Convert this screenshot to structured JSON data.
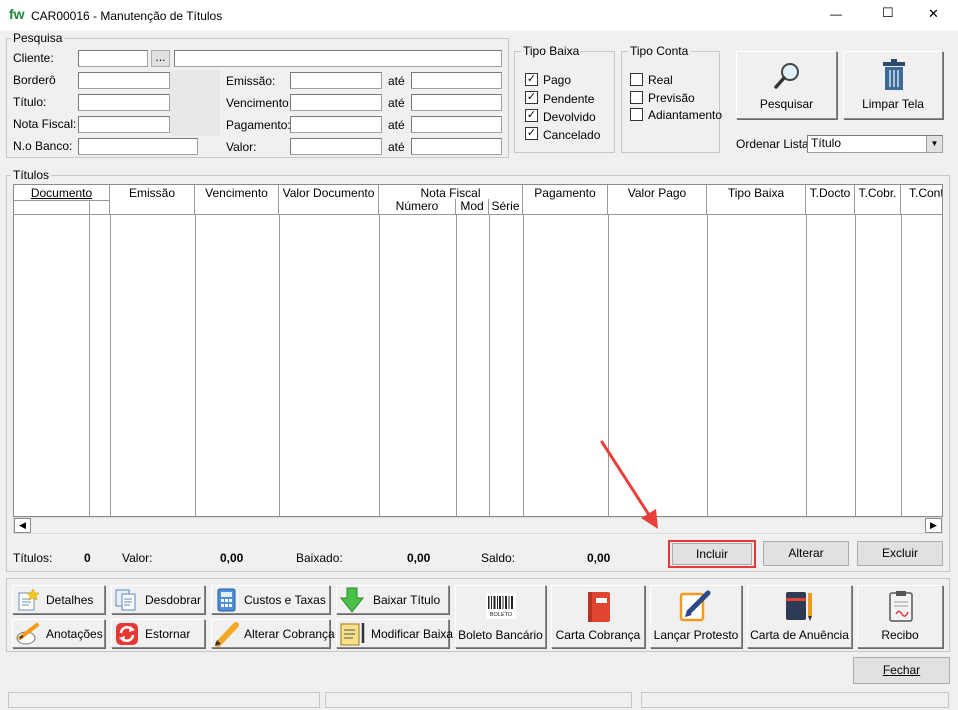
{
  "window": {
    "logo": "fw",
    "title": "CAR00016 - Manutenção de Títulos",
    "minimize_glyph": "—",
    "maximize_glyph": "☐",
    "close_glyph": "✕"
  },
  "pesquisa": {
    "title": "Pesquisa",
    "cliente_label": "Cliente:",
    "lookup_button": "...",
    "bordero_label": "Borderô",
    "titulo_label": "Título:",
    "nota_fiscal_label": "Nota Fiscal:",
    "no_banco_label": "N.o Banco:",
    "emissao_label": "Emissão:",
    "vencimento_label": "Vencimento:",
    "pagamento_label": "Pagamento:",
    "valor_label": "Valor:",
    "ate_label": "até"
  },
  "tipo_baixa": {
    "title": "Tipo Baixa",
    "options": [
      {
        "label": "Pago",
        "checked": true
      },
      {
        "label": "Pendente",
        "checked": true
      },
      {
        "label": "Devolvido",
        "checked": true
      },
      {
        "label": "Cancelado",
        "checked": true
      }
    ]
  },
  "tipo_conta": {
    "title": "Tipo Conta",
    "options": [
      {
        "label": "Real",
        "checked": false
      },
      {
        "label": "Previsão",
        "checked": false
      },
      {
        "label": "Adiantamento",
        "checked": false
      }
    ]
  },
  "actions": {
    "pesquisar": "Pesquisar",
    "limpar_tela": "Limpar Tela",
    "ordenar_label": "Ordenar Lista:",
    "ordenar_value": "Título"
  },
  "grid": {
    "title": "Títulos",
    "columns": {
      "documento": "Documento",
      "emissao": "Emissão",
      "vencimento": "Vencimento",
      "valor_documento": "Valor Documento",
      "nota_fiscal": "Nota Fiscal",
      "nf_numero": "Número",
      "nf_mod": "Mod",
      "nf_serie": "Série",
      "pagamento": "Pagamento",
      "valor_pago": "Valor Pago",
      "tipo_baixa": "Tipo Baixa",
      "t_docto": "T.Docto",
      "t_cobr": "T.Cobr.",
      "t_cont": "T.Cont"
    }
  },
  "totals": {
    "titulos_label": "Títulos:",
    "titulos_value": "0",
    "valor_label": "Valor:",
    "valor_value": "0,00",
    "baixado_label": "Baixado:",
    "baixado_value": "0,00",
    "saldo_label": "Saldo:",
    "saldo_value": "0,00"
  },
  "grid_buttons": {
    "incluir": "Incluir",
    "alterar": "Alterar",
    "excluir": "Excluir"
  },
  "toolbar": {
    "detalhes": "Detalhes",
    "desdobrar": "Desdobrar",
    "custos_taxas": "Custos e Taxas",
    "baixar_titulo": "Baixar Título",
    "anotacoes": "Anotações",
    "estornar": "Estornar",
    "alterar_cobranca": "Alterar Cobrança",
    "modificar_baixa": "Modificar Baixa",
    "boleto_bancario": "Boleto Bancário",
    "boleto_icon_text": "BOLETO",
    "carta_cobranca": "Carta Cobrança",
    "lancar_protesto": "Lançar Protesto",
    "carta_anuencia": "Carta de Anuência",
    "recibo": "Recibo"
  },
  "footer": {
    "fechar": "Fechar"
  },
  "colors": {
    "highlight": "#e53935",
    "arrow": "#e8403a"
  }
}
